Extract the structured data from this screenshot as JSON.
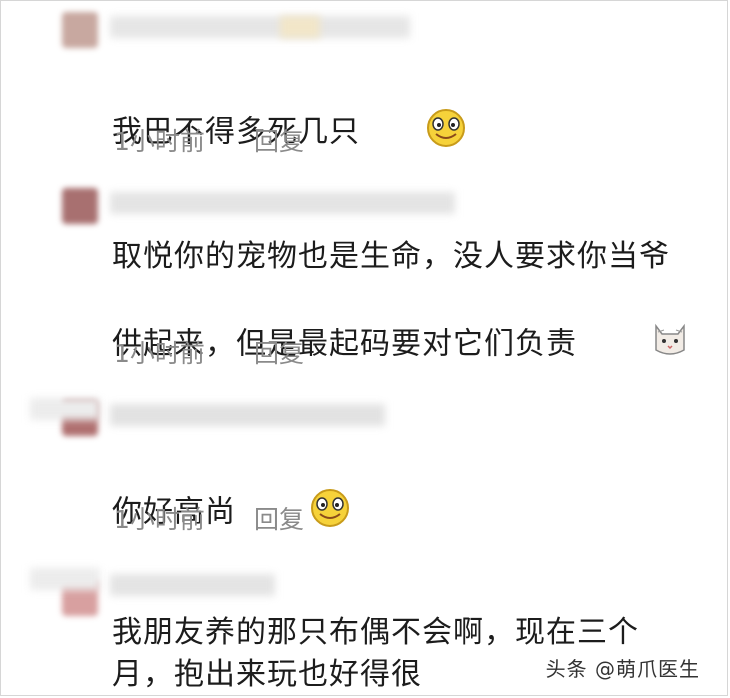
{
  "comments": [
    {
      "text": "我巴不得多死几只",
      "emoji": "smile-face-icon",
      "time": "1小时前",
      "reply": "回复"
    },
    {
      "text": "取悦你的宠物也是生命，没人要求你当爷\n供起来，但是最起码要对它们负责",
      "emoji": "cat-face-icon",
      "time": "1小时前",
      "reply": "回复"
    },
    {
      "text": "你好高尚",
      "emoji": "smile-face-icon",
      "time": "1小时前",
      "reply": "回复"
    },
    {
      "text": "我朋友养的那只布偶不会啊，现在三个\n月，抱出来玩也好得很"
    }
  ],
  "watermark": "头条 @萌爪医生",
  "colors": {
    "text": "#1c1c1c",
    "meta": "#8a8a8a",
    "avatar1": "#c8a8a0",
    "avatar2": "#a87070",
    "avatar3": "#b07070",
    "avatar4": "#d8a0a0"
  }
}
